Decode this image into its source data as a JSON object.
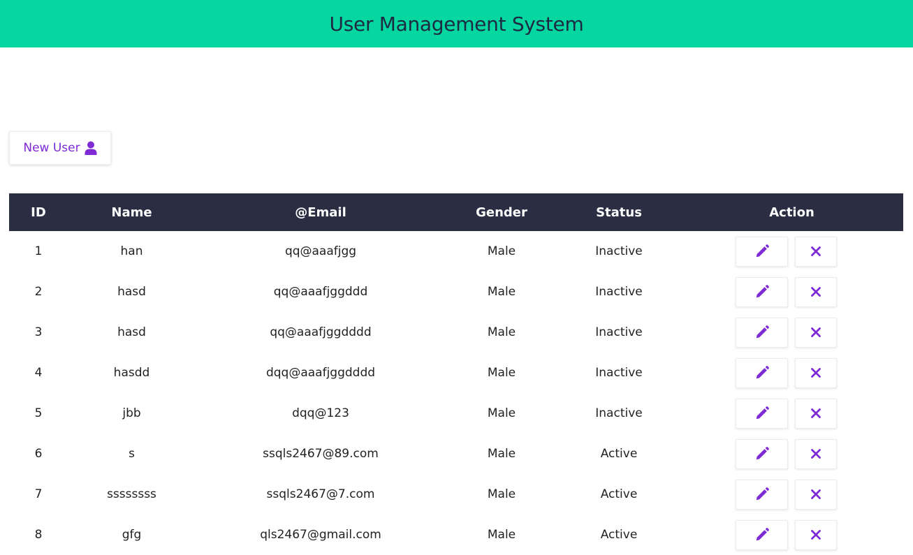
{
  "header": {
    "title": "User Management System",
    "background_color": "#06d6a0",
    "text_color": "#1d2a43"
  },
  "toolbar": {
    "new_user_label": "New User",
    "new_user_icon": "user-icon",
    "accent_color": "#7e2bd6"
  },
  "table": {
    "header_background": "#2b2d42",
    "columns": [
      "ID",
      "Name",
      "@Email",
      "Gender",
      "Status",
      "Action"
    ],
    "rows": [
      {
        "id": "1",
        "name": "han",
        "email": "qq@aaafjgg",
        "gender": "Male",
        "status": "Inactive"
      },
      {
        "id": "2",
        "name": "hasd",
        "email": "qq@aaafjggddd",
        "gender": "Male",
        "status": "Inactive"
      },
      {
        "id": "3",
        "name": "hasd",
        "email": "qq@aaafjggdddd",
        "gender": "Male",
        "status": "Inactive"
      },
      {
        "id": "4",
        "name": "hasdd",
        "email": "dqq@aaafjggdddd",
        "gender": "Male",
        "status": "Inactive"
      },
      {
        "id": "5",
        "name": "jbb",
        "email": "dqq@123",
        "gender": "Male",
        "status": "Inactive"
      },
      {
        "id": "6",
        "name": "s",
        "email": "ssqls2467@89.com",
        "gender": "Male",
        "status": "Active"
      },
      {
        "id": "7",
        "name": "ssssssss",
        "email": "ssqls2467@7.com",
        "gender": "Male",
        "status": "Active"
      },
      {
        "id": "8",
        "name": "gfg",
        "email": "qls2467@gmail.com",
        "gender": "Male",
        "status": "Active"
      }
    ],
    "action_icons": [
      "pencil-icon",
      "close-icon"
    ]
  }
}
